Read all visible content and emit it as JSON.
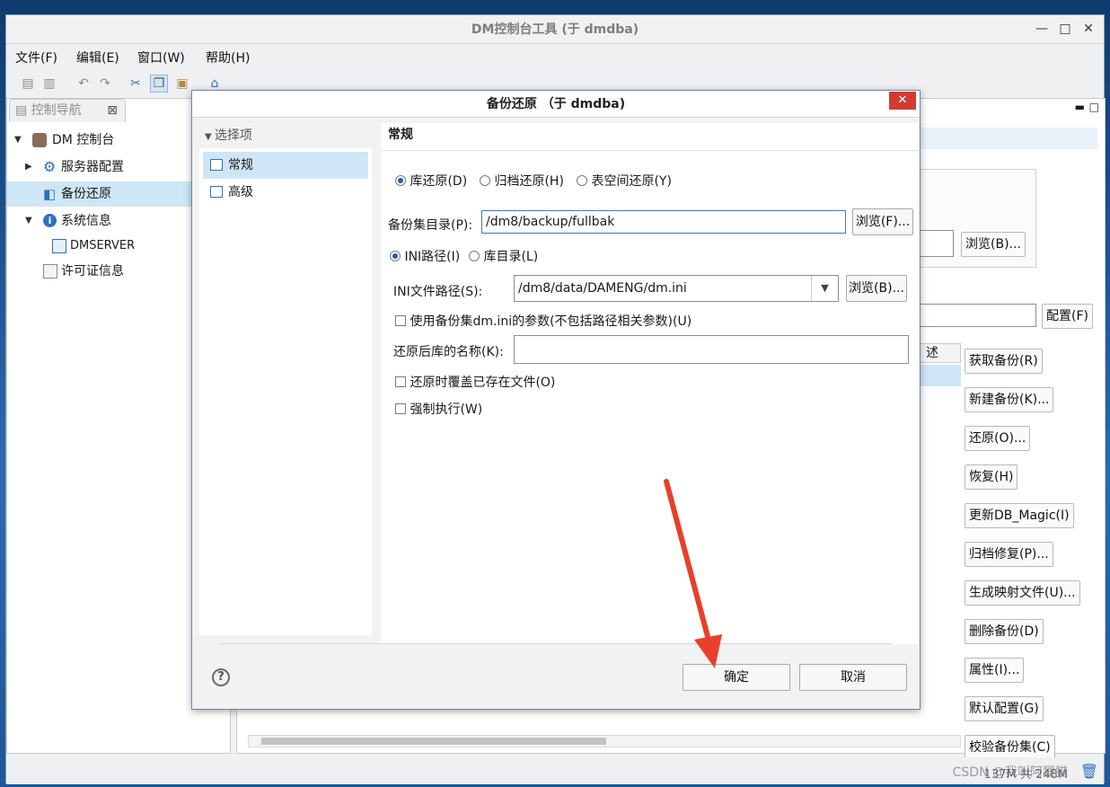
{
  "window": {
    "title": "DM控制台工具 (于 dmdba)"
  },
  "menu": [
    "文件(F)",
    "编辑(E)",
    "窗口(W)",
    "帮助(H)"
  ],
  "nav": {
    "tab_label": "控制导航",
    "tree": [
      {
        "label": "DM 控制台",
        "icon": "database-icon"
      },
      {
        "label": "服务器配置",
        "icon": "gear-icon"
      },
      {
        "label": "备份还原",
        "icon": "backup-icon"
      },
      {
        "label": "系统信息",
        "icon": "info-icon"
      },
      {
        "label": "DMSERVER",
        "icon": "table-icon"
      },
      {
        "label": "许可证信息",
        "icon": "license-icon"
      }
    ]
  },
  "right": {
    "browse_label": "浏览(B)...",
    "config_label": "配置(F)",
    "column_stub": "述",
    "actions": [
      "获取备份(R)",
      "新建备份(K)...",
      "还原(O)...",
      "恢复(H)",
      "更新DB_Magic(I)",
      "归档修复(P)...",
      "生成映射文件(U)...",
      "删除备份(D)",
      "属性(I)...",
      "默认配置(G)",
      "校验备份集(C)"
    ]
  },
  "status": {
    "memory": "137M 共 248M",
    "watermark": "CSDN @我叫阿狸猫"
  },
  "dialog": {
    "title": "备份还原 （于 dmdba)",
    "options_header": "选择项",
    "options": [
      "常规",
      "高级"
    ],
    "section_title": "常规",
    "restore_types": [
      "库还原(D)",
      "归档还原(H)",
      "表空间还原(Y)"
    ],
    "backup_dir_label": "备份集目录(P):",
    "backup_dir_value": "/dm8/backup/fullbak",
    "browse_f": "浏览(F)...",
    "path_types": [
      "INI路径(I)",
      "库目录(L)"
    ],
    "ini_label": "INI文件路径(S):",
    "ini_value": "/dm8/data/DAMENG/dm.ini",
    "browse_b": "浏览(B)...",
    "use_backup_ini": "使用备份集dm.ini的参数(不包括路径相关参数)(U)",
    "restored_name_label": "还原后库的名称(K):",
    "restored_name_value": "",
    "overwrite": "还原时覆盖已存在文件(O)",
    "force": "强制执行(W)",
    "ok": "确定",
    "cancel": "取消",
    "help": "?"
  },
  "colors": {
    "selection": "#cfe6f7",
    "arrow": "#e8402a",
    "close": "#d33b32"
  }
}
